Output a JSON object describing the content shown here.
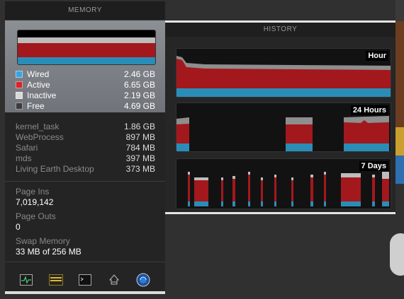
{
  "memory_panel": {
    "title": "MEMORY",
    "legend": [
      {
        "label": "Wired",
        "value": "2.46 GB",
        "color": "#3ba3e0"
      },
      {
        "label": "Active",
        "value": "6.65 GB",
        "color": "#d0282d"
      },
      {
        "label": "Inactive",
        "value": "2.19 GB",
        "color": "#d8d8d8"
      },
      {
        "label": "Free",
        "value": "4.69 GB",
        "color": "#3c3c3c"
      }
    ],
    "processes": [
      {
        "name": "kernel_task",
        "value": "1.86 GB"
      },
      {
        "name": "WebProcess",
        "value": "897 MB"
      },
      {
        "name": "Safari",
        "value": "784 MB"
      },
      {
        "name": "mds",
        "value": "397 MB"
      },
      {
        "name": "Living Earth Desktop",
        "value": "373 MB"
      }
    ],
    "stats": {
      "page_ins_label": "Page Ins",
      "page_ins_value": "7,019,142",
      "page_outs_label": "Page Outs",
      "page_outs_value": "0",
      "swap_label": "Swap Memory",
      "swap_value": "33 MB of 256 MB"
    },
    "toolbar_icons": [
      "activity-monitor-icon",
      "console-icon",
      "terminal-icon",
      "disk-utility-icon",
      "network-utility-icon"
    ]
  },
  "history_panel": {
    "title": "HISTORY",
    "graphs": [
      {
        "label": "Hour"
      },
      {
        "label": "24 Hours"
      },
      {
        "label": "7 Days"
      }
    ]
  }
}
